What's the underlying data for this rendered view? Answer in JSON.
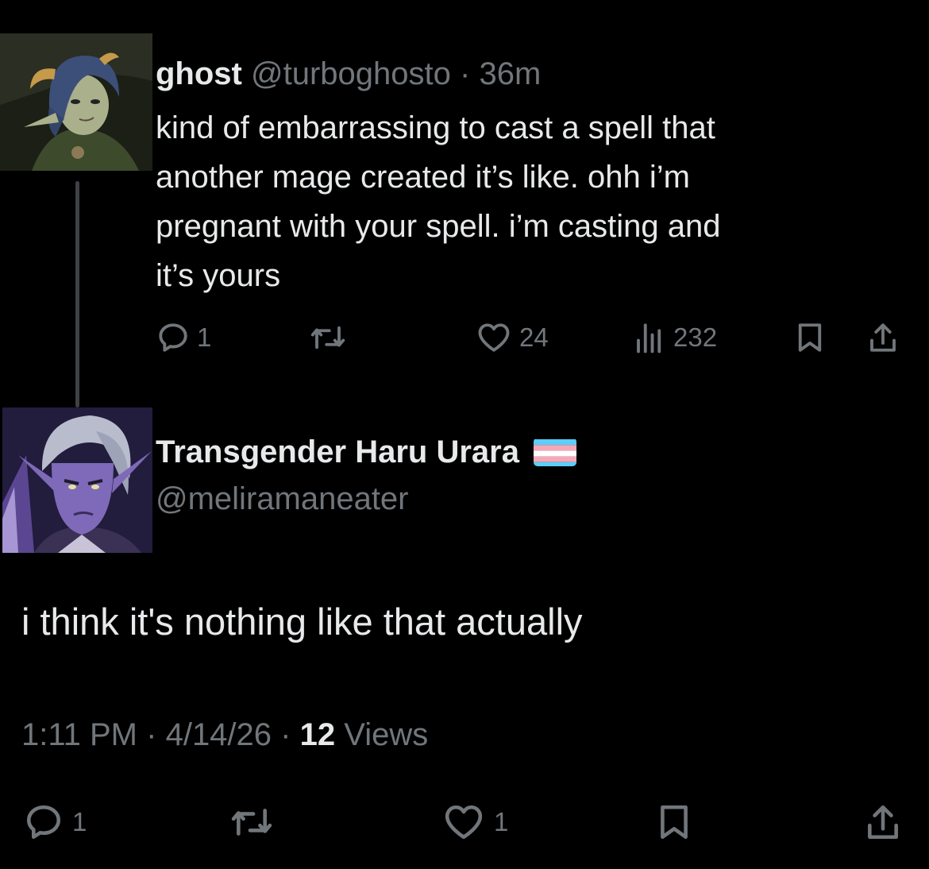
{
  "parent_tweet": {
    "display_name": "ghost",
    "handle": "@turboghosto",
    "separator": "·",
    "time_ago": "36m",
    "text": "kind of embarrassing to cast a spell that\nanother mage created it’s like. ohh i’m\npregnant with your spell. i’m casting and\nit’s yours",
    "actions": {
      "replies": "1",
      "likes": "24",
      "views": "232"
    }
  },
  "reply_tweet": {
    "display_name": "Transgender Haru Urara",
    "handle": "@meliramaneater",
    "text": "i think it's nothing like that actually",
    "meta": {
      "time": "1:11 PM",
      "dot1": "·",
      "date": "4/14/26",
      "dot2": "·",
      "views_count": "12",
      "views_label": "Views"
    },
    "actions": {
      "replies": "1",
      "likes": "1"
    }
  },
  "colors": {
    "background": "#000000",
    "text": "#e7e9ea",
    "secondary": "#71767b",
    "thread_line": "#3e4144",
    "flag_blue": "#5bcefa",
    "flag_pink": "#f5a9b8",
    "flag_white": "#ffffff"
  },
  "icons": [
    "reply-icon",
    "retweet-icon",
    "like-icon",
    "views-icon",
    "bookmark-icon",
    "share-icon"
  ]
}
